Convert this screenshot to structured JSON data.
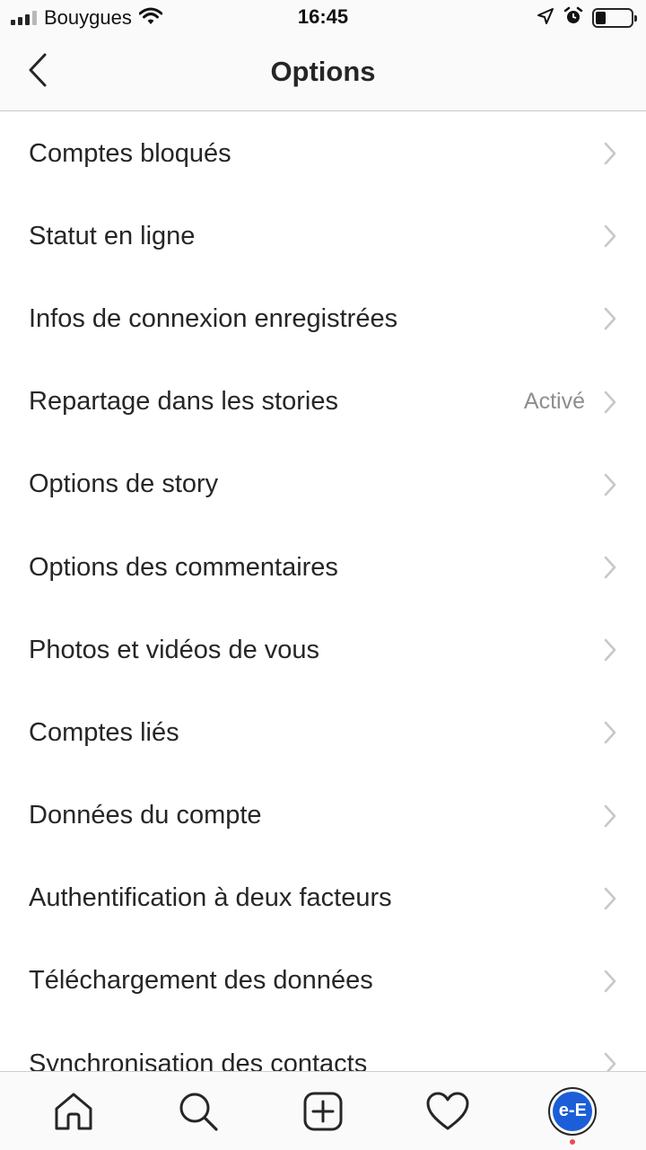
{
  "status_bar": {
    "carrier": "Bouygues",
    "time": "16:45",
    "signal_bars_filled": 3,
    "signal_bars_total": 4,
    "battery_level": 0.3,
    "icons": [
      "signal-icon",
      "wifi-icon",
      "location-arrow-icon",
      "alarm-icon",
      "battery-icon"
    ]
  },
  "header": {
    "title": "Options",
    "back_icon": "chevron-left-icon"
  },
  "settings": [
    {
      "label": "Comptes bloqués",
      "value": ""
    },
    {
      "label": "Statut en ligne",
      "value": ""
    },
    {
      "label": "Infos de connexion enregistrées",
      "value": ""
    },
    {
      "label": "Repartage dans les stories",
      "value": "Activé"
    },
    {
      "label": "Options de story",
      "value": ""
    },
    {
      "label": "Options des commentaires",
      "value": ""
    },
    {
      "label": "Photos et vidéos de vous",
      "value": ""
    },
    {
      "label": "Comptes liés",
      "value": ""
    },
    {
      "label": "Données du compte",
      "value": ""
    },
    {
      "label": "Authentification à deux facteurs",
      "value": ""
    },
    {
      "label": "Téléchargement des données",
      "value": ""
    },
    {
      "label": "Synchronisation des contacts",
      "value": ""
    }
  ],
  "tab_bar": {
    "tabs": [
      "home-icon",
      "search-icon",
      "add-post-icon",
      "activity-heart-icon",
      "profile-avatar"
    ],
    "avatar_text": "e-E",
    "avatar_color": "#1b5ed8",
    "notification_dot_color": "#ed4956"
  }
}
